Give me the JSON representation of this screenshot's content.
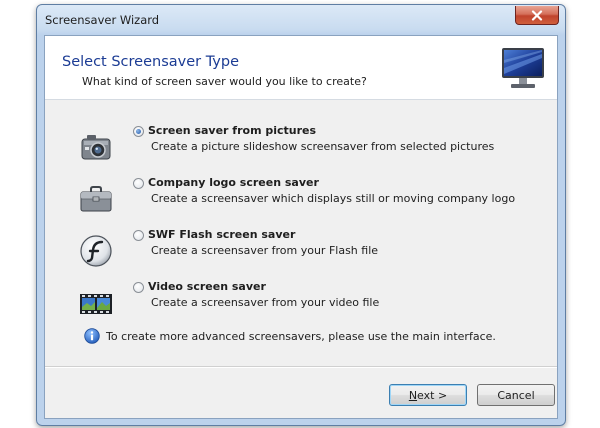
{
  "window": {
    "title": "Screensaver Wizard"
  },
  "header": {
    "title": "Select Screensaver Type",
    "subtitle": "What kind of screen saver would you like to create?"
  },
  "options": [
    {
      "title": "Screen saver from pictures",
      "description": "Create a picture slideshow screensaver from selected pictures",
      "checked": true,
      "icon": "camera-icon"
    },
    {
      "title": "Company logo screen saver",
      "description": "Create a screensaver which displays still or moving company logo",
      "checked": false,
      "icon": "briefcase-icon"
    },
    {
      "title": "SWF Flash screen saver",
      "description": "Create a screensaver from your Flash file",
      "checked": false,
      "icon": "flash-icon"
    },
    {
      "title": "Video screen saver",
      "description": "Create a screensaver from your video file",
      "checked": false,
      "icon": "film-strip-icon"
    }
  ],
  "info": {
    "text": "To create more advanced screensavers, please use the main interface.",
    "icon": "info-icon"
  },
  "buttons": {
    "next_accel": "N",
    "next_rest": "ext >",
    "cancel": "Cancel"
  },
  "colors": {
    "header_title": "#1c3c94",
    "selected_radio": "#1e56a8",
    "close_button": "#c0432d"
  }
}
